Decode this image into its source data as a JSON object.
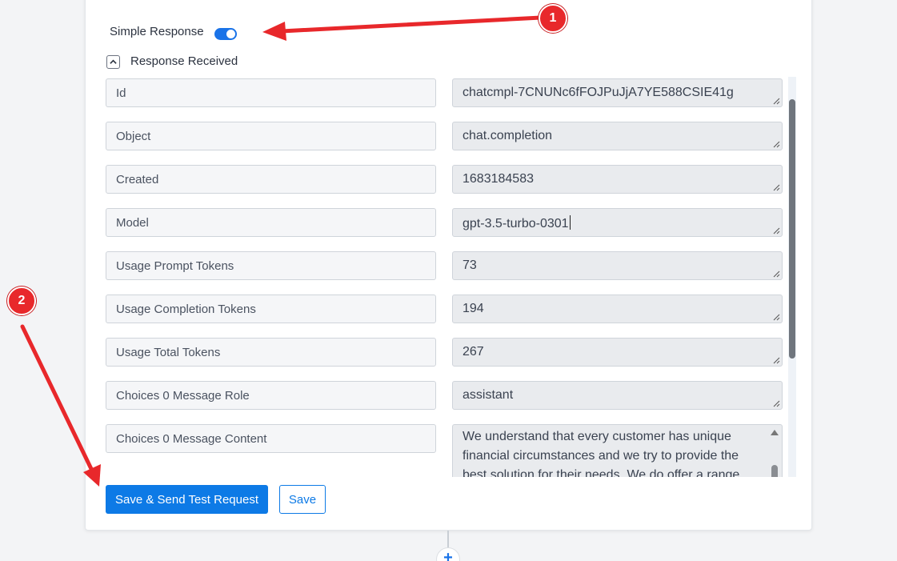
{
  "header": {
    "simple_response_label": "Simple Response",
    "simple_response_on": true,
    "response_received_label": "Response Received"
  },
  "fields": [
    {
      "key": "Id",
      "value": "chatcmpl-7CNUNc6fFOJPuJjA7YE588CSIE41g"
    },
    {
      "key": "Object",
      "value": "chat.completion"
    },
    {
      "key": "Created",
      "value": "1683184583"
    },
    {
      "key": "Model",
      "value": "gpt-3.5-turbo-0301"
    },
    {
      "key": "Usage Prompt Tokens",
      "value": "73"
    },
    {
      "key": "Usage Completion Tokens",
      "value": "194"
    },
    {
      "key": "Usage Total Tokens",
      "value": "267"
    },
    {
      "key": "Choices 0 Message Role",
      "value": "assistant"
    },
    {
      "key": "Choices 0 Message Content",
      "value": "We understand that every customer has unique financial circumstances and we try to provide the best solution for their needs. We do offer a range"
    }
  ],
  "buttons": {
    "save_send": "Save & Send Test Request",
    "save": "Save"
  },
  "add_step": "+",
  "annotations": {
    "badge_1": "1",
    "badge_2": "2"
  },
  "colors": {
    "accent": "#0d7ae6",
    "annotation": "#e8282b"
  }
}
